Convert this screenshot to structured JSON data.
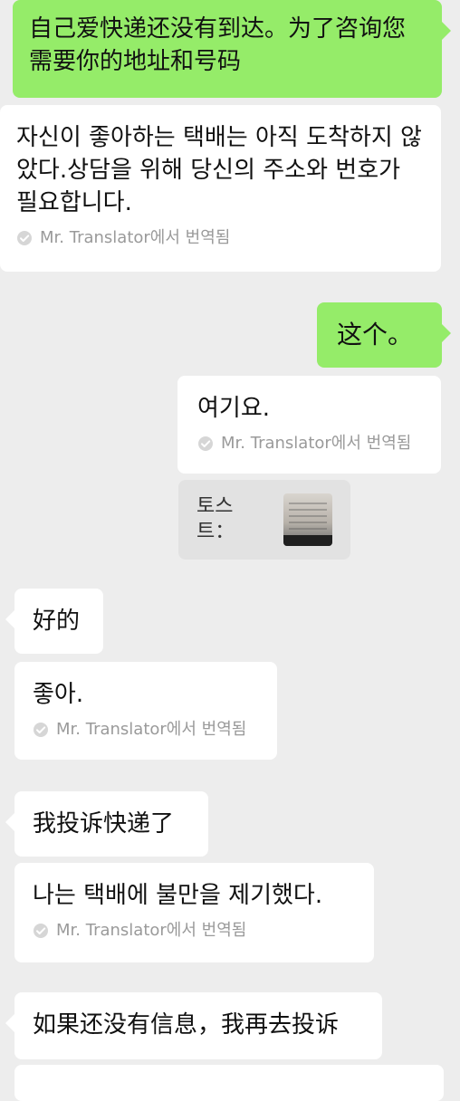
{
  "messages": [
    {
      "side": "right",
      "style": "green",
      "text": "自己爱快递还没有到达。为了咨询您需要你的地址和号码"
    },
    {
      "side": "left",
      "style": "white",
      "text": "자신이 좋아하는 택배는 아직 도착하지 않았다.상담을 위해 당신의 주소와 번호가 필요합니다.",
      "note": "Mr. Translator에서 번역됨"
    },
    {
      "side": "right",
      "style": "green",
      "text": "这个。"
    },
    {
      "side": "right",
      "style": "white",
      "text": "여기요.",
      "note": "Mr. Translator에서 번역됨"
    },
    {
      "side": "right",
      "style": "grey",
      "label": "토스트："
    },
    {
      "side": "left",
      "style": "white",
      "text": "好的"
    },
    {
      "side": "left",
      "style": "white",
      "text": "좋아.",
      "note": "Mr. Translator에서 번역됨"
    },
    {
      "side": "left",
      "style": "white",
      "text": "我投诉快递了"
    },
    {
      "side": "left",
      "style": "white",
      "text": "나는 택배에 불만을 제기했다.",
      "note": "Mr. Translator에서 번역됨"
    },
    {
      "side": "left",
      "style": "white",
      "text": "如果还没有信息，我再去投诉"
    }
  ],
  "icons": {
    "translated": "check-circle-icon",
    "thumbnail": "image-thumbnail"
  },
  "colors": {
    "background": "#ededed",
    "outgoing": "#95ec69",
    "incoming": "#ffffff",
    "grey_box": "#e2e2e2",
    "note_text": "#9a9a9a"
  }
}
